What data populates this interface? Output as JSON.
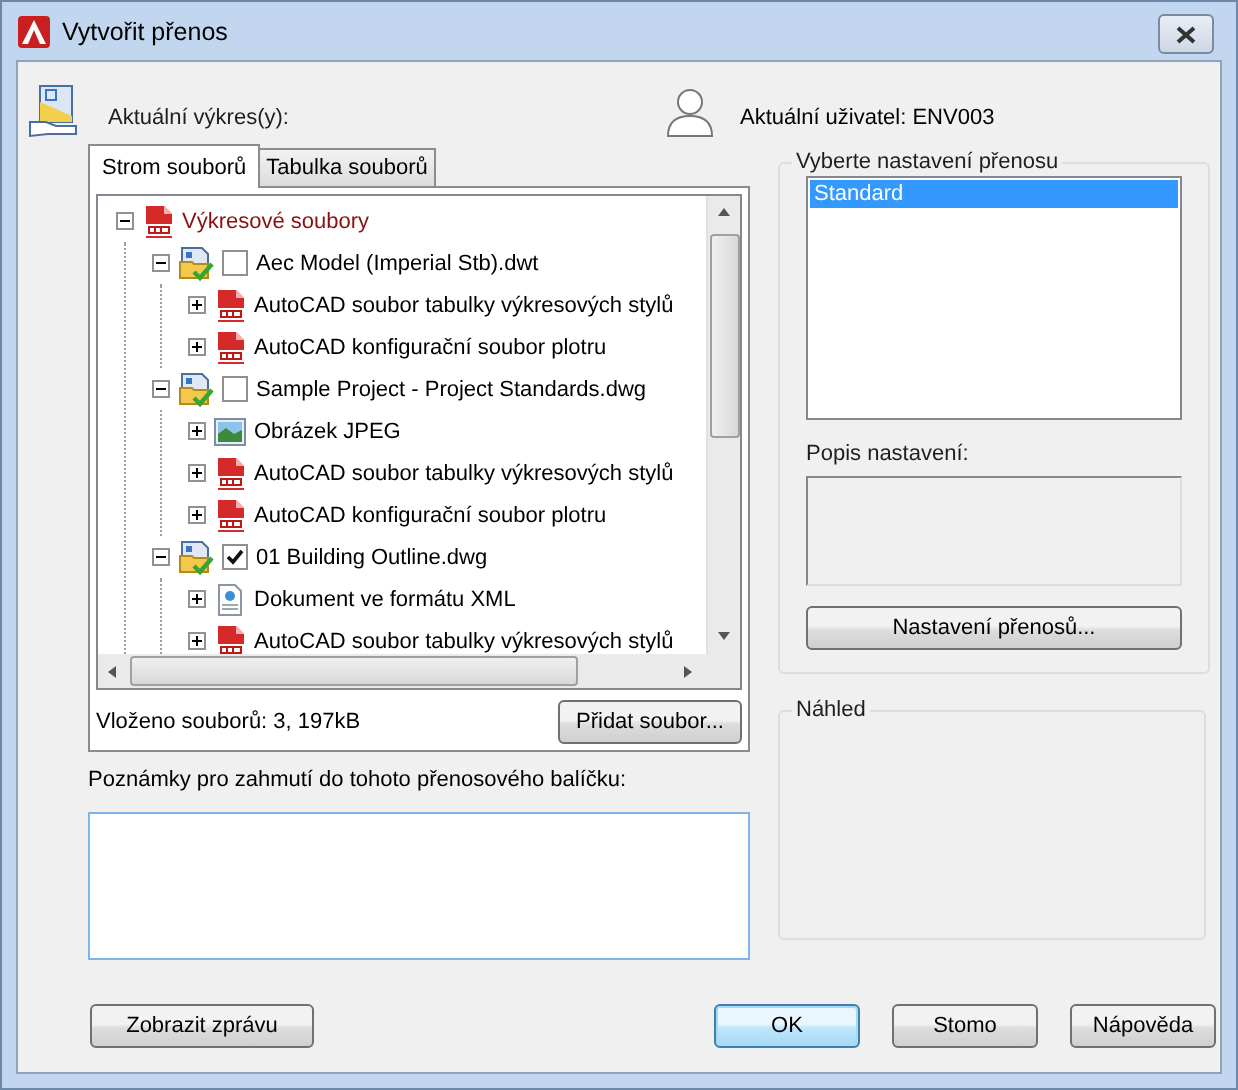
{
  "window": {
    "title": "Vytvořit přenos"
  },
  "drawings_label": "Aktuální výkres(y):",
  "user_label": "Aktuální uživatel: ENV003",
  "tabs": [
    {
      "label": "Strom souborů",
      "selected": true
    },
    {
      "label": "Tabulka souborů",
      "selected": false
    }
  ],
  "tree": [
    {
      "label": "Výkresové soubory",
      "kind": "dwt",
      "expanded": true,
      "children": [
        {
          "label": "Aec Model (Imperial Stb).dwt",
          "kind": "drawing",
          "checked": false,
          "expanded": true,
          "children": [
            {
              "label": "AutoCAD soubor tabulky výkresových stylů",
              "kind": "stb",
              "expanded": false
            },
            {
              "label": "AutoCAD konfigurační soubor plotru",
              "kind": "pc3",
              "expanded": false
            }
          ]
        },
        {
          "label": "Sample Project - Project Standards.dwg",
          "kind": "drawing",
          "checked": false,
          "expanded": true,
          "children": [
            {
              "label": "Obrázek JPEG",
              "kind": "jpeg",
              "expanded": false
            },
            {
              "label": "AutoCAD soubor tabulky výkresových stylů",
              "kind": "stb",
              "expanded": false
            },
            {
              "label": "AutoCAD konfigurační soubor plotru",
              "kind": "pc3",
              "expanded": false
            }
          ]
        },
        {
          "label": "01 Building Outline.dwg",
          "kind": "drawing",
          "checked": true,
          "expanded": true,
          "children": [
            {
              "label": "Dokument ve formátu XML",
              "kind": "xml",
              "expanded": false
            },
            {
              "label": "AutoCAD soubor tabulky výkresových stylů",
              "kind": "stb",
              "expanded": false
            }
          ]
        }
      ]
    }
  ],
  "file_summary": "Vloženo souborů: 3, 197kB",
  "add_file_button": "Přidat soubor...",
  "notes": {
    "label": "Poznámky pro zahmutí do tohoto přenosového balíčku:"
  },
  "transfer_setups": {
    "title": "Vyberte nastavení přenosu",
    "items": [
      {
        "label": "Standard",
        "selected": true
      }
    ],
    "description_label": "Popis nastavení:",
    "button": "Nastavení přenosů..."
  },
  "preview": {
    "title": "Náhled"
  },
  "report_button": "Zobrazit zprávu",
  "buttons": [
    {
      "label": "OK",
      "default": true
    },
    {
      "label": "Stomo",
      "default": false
    },
    {
      "label": "Nápověda",
      "default": false
    }
  ]
}
